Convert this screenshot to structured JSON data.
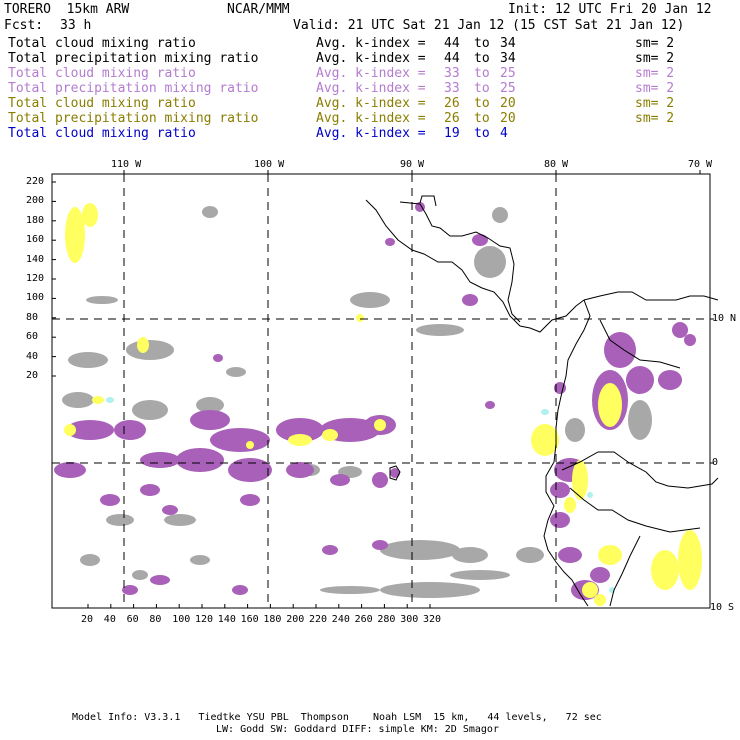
{
  "header": {
    "model": "TORERO  15km ARW",
    "org": "NCAR/MMM",
    "init": "Init: 12 UTC Fri 20 Jan 12",
    "fcst_label": "Fcst:",
    "fcst_value": "33 h",
    "valid": "Valid: 21 UTC Sat 21 Jan 12 (15 CST Sat 21 Jan 12)"
  },
  "legend": [
    {
      "field": "Total cloud mixing ratio",
      "index": "Avg. k-index =",
      "from": "44",
      "to_word": "to",
      "to": "34",
      "sm": "sm= 2",
      "color": "#000000"
    },
    {
      "field": "Total precipitation mixing ratio",
      "index": "Avg. k-index =",
      "from": "44",
      "to_word": "to",
      "to": "34",
      "sm": "sm= 2",
      "color": "#000000"
    },
    {
      "field": "Total cloud mixing ratio",
      "index": "Avg. k-index =",
      "from": "33",
      "to_word": "to",
      "to": "25",
      "sm": "sm= 2",
      "color": "#b47cd0"
    },
    {
      "field": "Total precipitation mixing ratio",
      "index": "Avg. k-index =",
      "from": "33",
      "to_word": "to",
      "to": "25",
      "sm": "sm= 2",
      "color": "#b47cd0"
    },
    {
      "field": "Total cloud mixing ratio",
      "index": "Avg. k-index =",
      "from": "26",
      "to_word": "to",
      "to": "20",
      "sm": "sm= 2",
      "color": "#8a7e00"
    },
    {
      "field": "Total precipitation mixing ratio",
      "index": "Avg. k-index =",
      "from": "26",
      "to_word": "to",
      "to": "20",
      "sm": "sm= 2",
      "color": "#8a7e00"
    },
    {
      "field": "Total cloud mixing ratio",
      "index": "Avg. k-index =",
      "from": "19",
      "to_word": "to",
      "to": "4",
      "sm": "",
      "color": "#0000c8"
    }
  ],
  "map": {
    "lon_labels": [
      "110 W",
      "100 W",
      "90 W",
      "80 W",
      "70 W"
    ],
    "lat_labels": [
      "10 N",
      "0",
      "10 S"
    ],
    "y_ticks": [
      "220",
      "200",
      "180",
      "160",
      "140",
      "120",
      "100",
      "80",
      "60",
      "40",
      "20"
    ],
    "x_ticks": [
      "20",
      "40",
      "60",
      "80",
      "100",
      "120",
      "140",
      "160",
      "180",
      "200",
      "220",
      "240",
      "260",
      "280",
      "300",
      "320"
    ],
    "colors": {
      "gray": "#a8a8a8",
      "purple": "#a860b8",
      "yellow": "#ffff60",
      "cyan": "#b0f0f0"
    }
  },
  "footer": {
    "line1": "Model Info: V3.3.1   Tiedtke YSU PBL  Thompson    Noah LSM  15 km,   44 levels,   72 sec",
    "line2": "LW: Godd SW: Goddard DIFF: simple KM: 2D Smagor"
  }
}
